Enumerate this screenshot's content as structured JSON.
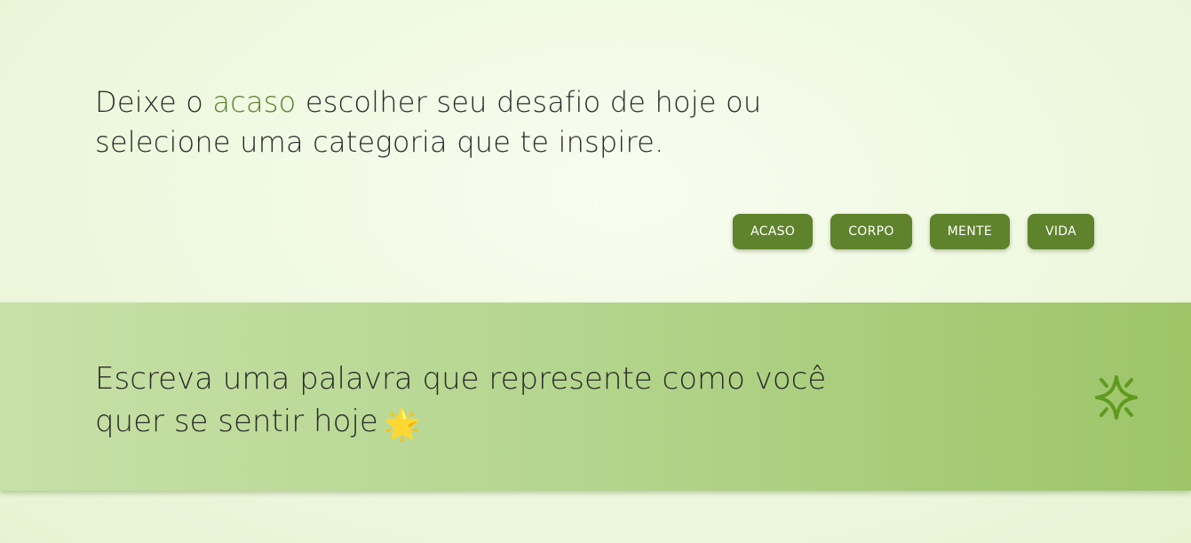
{
  "intro": {
    "before": "Deixe o ",
    "highlight": "acaso",
    "after": " escolher seu desafio de hoje ou selecione uma categoria que te inspire."
  },
  "categories": [
    {
      "label": "ACASO"
    },
    {
      "label": "CORPO"
    },
    {
      "label": "MENTE"
    },
    {
      "label": "VIDA"
    }
  ],
  "challenge": {
    "text": "Escreva uma palavra que represente como você quer se sentir hoje",
    "emoji": "🌟"
  },
  "icons": {
    "refresh": "sparkle-icon"
  },
  "colors": {
    "accent": "#5f822c",
    "highlight_text": "#5b7f2c",
    "sparkle": "#5f9a1f",
    "banner_start": "#c7e0a7",
    "banner_end": "#9dc568"
  }
}
